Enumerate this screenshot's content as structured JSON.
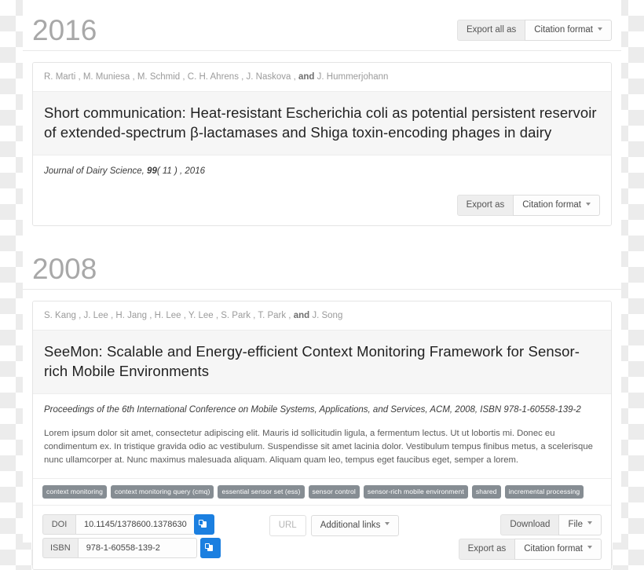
{
  "groups": [
    {
      "year": "2016",
      "export_all_label": "Export all as",
      "citation_format_label": "Citation format",
      "publication": {
        "authors_prefix": "R. Marti , M. Muniesa , M. Schmid , C. H. Ahrens , J. Naskova , ",
        "authors_and": "and",
        "authors_suffix": " J. Hummerjohann",
        "title": "Short communication: Heat-resistant Escherichia coli as potential persistent reservoir of extended-spectrum β-lactamases and Shiga toxin-encoding phages in dairy",
        "meta_journal": "Journal of Dairy Science, ",
        "meta_volume": "99",
        "meta_rest": "( 11 ) , 2016",
        "export_label": "Export as",
        "citation_format_label": "Citation format"
      }
    },
    {
      "year": "2008",
      "publication": {
        "authors_prefix": "S. Kang , J. Lee , H. Jang , H. Lee , Y. Lee , S. Park , T. Park , ",
        "authors_and": "and",
        "authors_suffix": " J. Song",
        "title": "SeeMon: Scalable and Energy-efficient Context Monitoring Framework for Sensor-rich Mobile Environments",
        "meta_full": "Proceedings of the 6th International Conference on Mobile Systems, Applications, and Services, ACM, 2008, ISBN 978-1-60558-139-2",
        "abstract": "Lorem ipsum dolor sit amet, consectetur adipiscing elit. Mauris id sollicitudin ligula, a fermentum lectus. Ut ut lobortis mi. Donec eu condimentum ex. In tristique gravida odio ac vestibulum. Suspendisse sit amet lacinia dolor. Vestibulum tempus finibus metus, a scelerisque nunc ullamcorper at. Nunc maximus malesuada aliquam. Aliquam quam leo, tempus eget faucibus eget, semper a lorem.",
        "keywords": [
          "context monitoring",
          "context monitoring query (cmq)",
          "essential sensor set (ess)",
          "sensor control",
          "sensor-rich mobile environment",
          "shared",
          "incremental processing"
        ],
        "identifiers": [
          {
            "label": "DOI",
            "value": "10.1145/1378600.1378630"
          },
          {
            "label": "ISBN",
            "value": "978-1-60558-139-2"
          }
        ],
        "url_label": "URL",
        "additional_links_label": "Additional links",
        "download_label": "Download",
        "file_label": "File",
        "export_label": "Export as",
        "citation_format_label": "Citation format"
      }
    }
  ],
  "colors": {
    "accent_blue": "#1b7fe0",
    "keyword_grey": "#868d93",
    "year_grey": "#a8a8a8",
    "panel_grey": "#f6f6f6"
  }
}
